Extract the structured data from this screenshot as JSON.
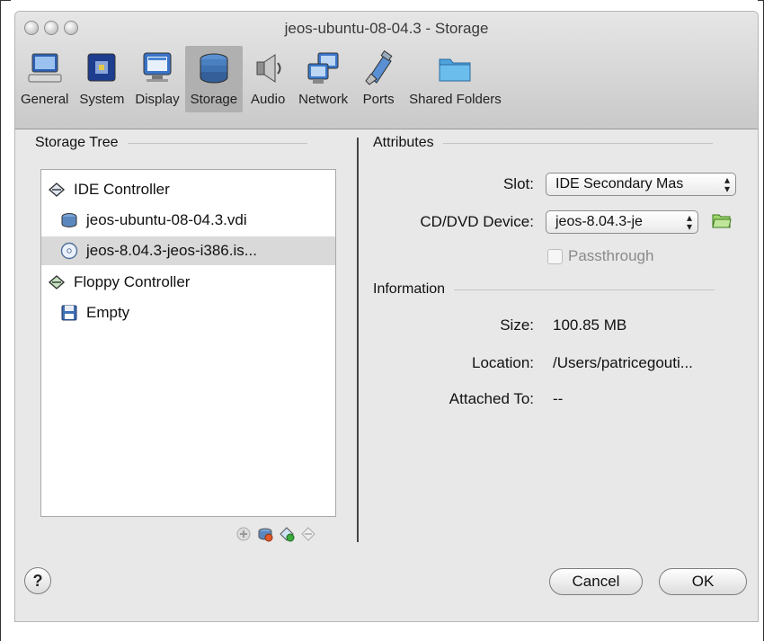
{
  "window": {
    "title": "jeos-ubuntu-08-04.3 - Storage"
  },
  "toolbar": {
    "items": [
      {
        "label": "General",
        "icon": "general-icon"
      },
      {
        "label": "System",
        "icon": "system-icon"
      },
      {
        "label": "Display",
        "icon": "display-icon"
      },
      {
        "label": "Storage",
        "icon": "storage-icon",
        "active": true
      },
      {
        "label": "Audio",
        "icon": "audio-icon"
      },
      {
        "label": "Network",
        "icon": "network-icon"
      },
      {
        "label": "Ports",
        "icon": "ports-icon"
      },
      {
        "label": "Shared Folders",
        "icon": "shared-folders-icon"
      }
    ]
  },
  "storage_tree": {
    "heading": "Storage Tree",
    "nodes": [
      {
        "label": "IDE Controller",
        "icon": "ide-controller-icon"
      },
      {
        "label": "jeos-ubuntu-08-04.3.vdi",
        "icon": "hard-disk-icon"
      },
      {
        "label": "jeos-8.04.3-jeos-i386.is...",
        "icon": "cd-icon",
        "selected": true
      },
      {
        "label": "Floppy Controller",
        "icon": "floppy-controller-icon"
      },
      {
        "label": "Empty",
        "icon": "floppy-disk-icon"
      }
    ]
  },
  "attributes": {
    "heading": "Attributes",
    "slot_label": "Slot:",
    "slot_value": "IDE Secondary Mas",
    "cd_label": "CD/DVD Device:",
    "cd_value": "jeos-8.04.3-je",
    "passthrough_label": "Passthrough"
  },
  "information": {
    "heading": "Information",
    "size_label": "Size:",
    "size_value": "100.85 MB",
    "location_label": "Location:",
    "location_value": "/Users/patricegouti...",
    "attached_label": "Attached To:",
    "attached_value": "--"
  },
  "buttons": {
    "cancel": "Cancel",
    "ok": "OK",
    "help": "?"
  }
}
